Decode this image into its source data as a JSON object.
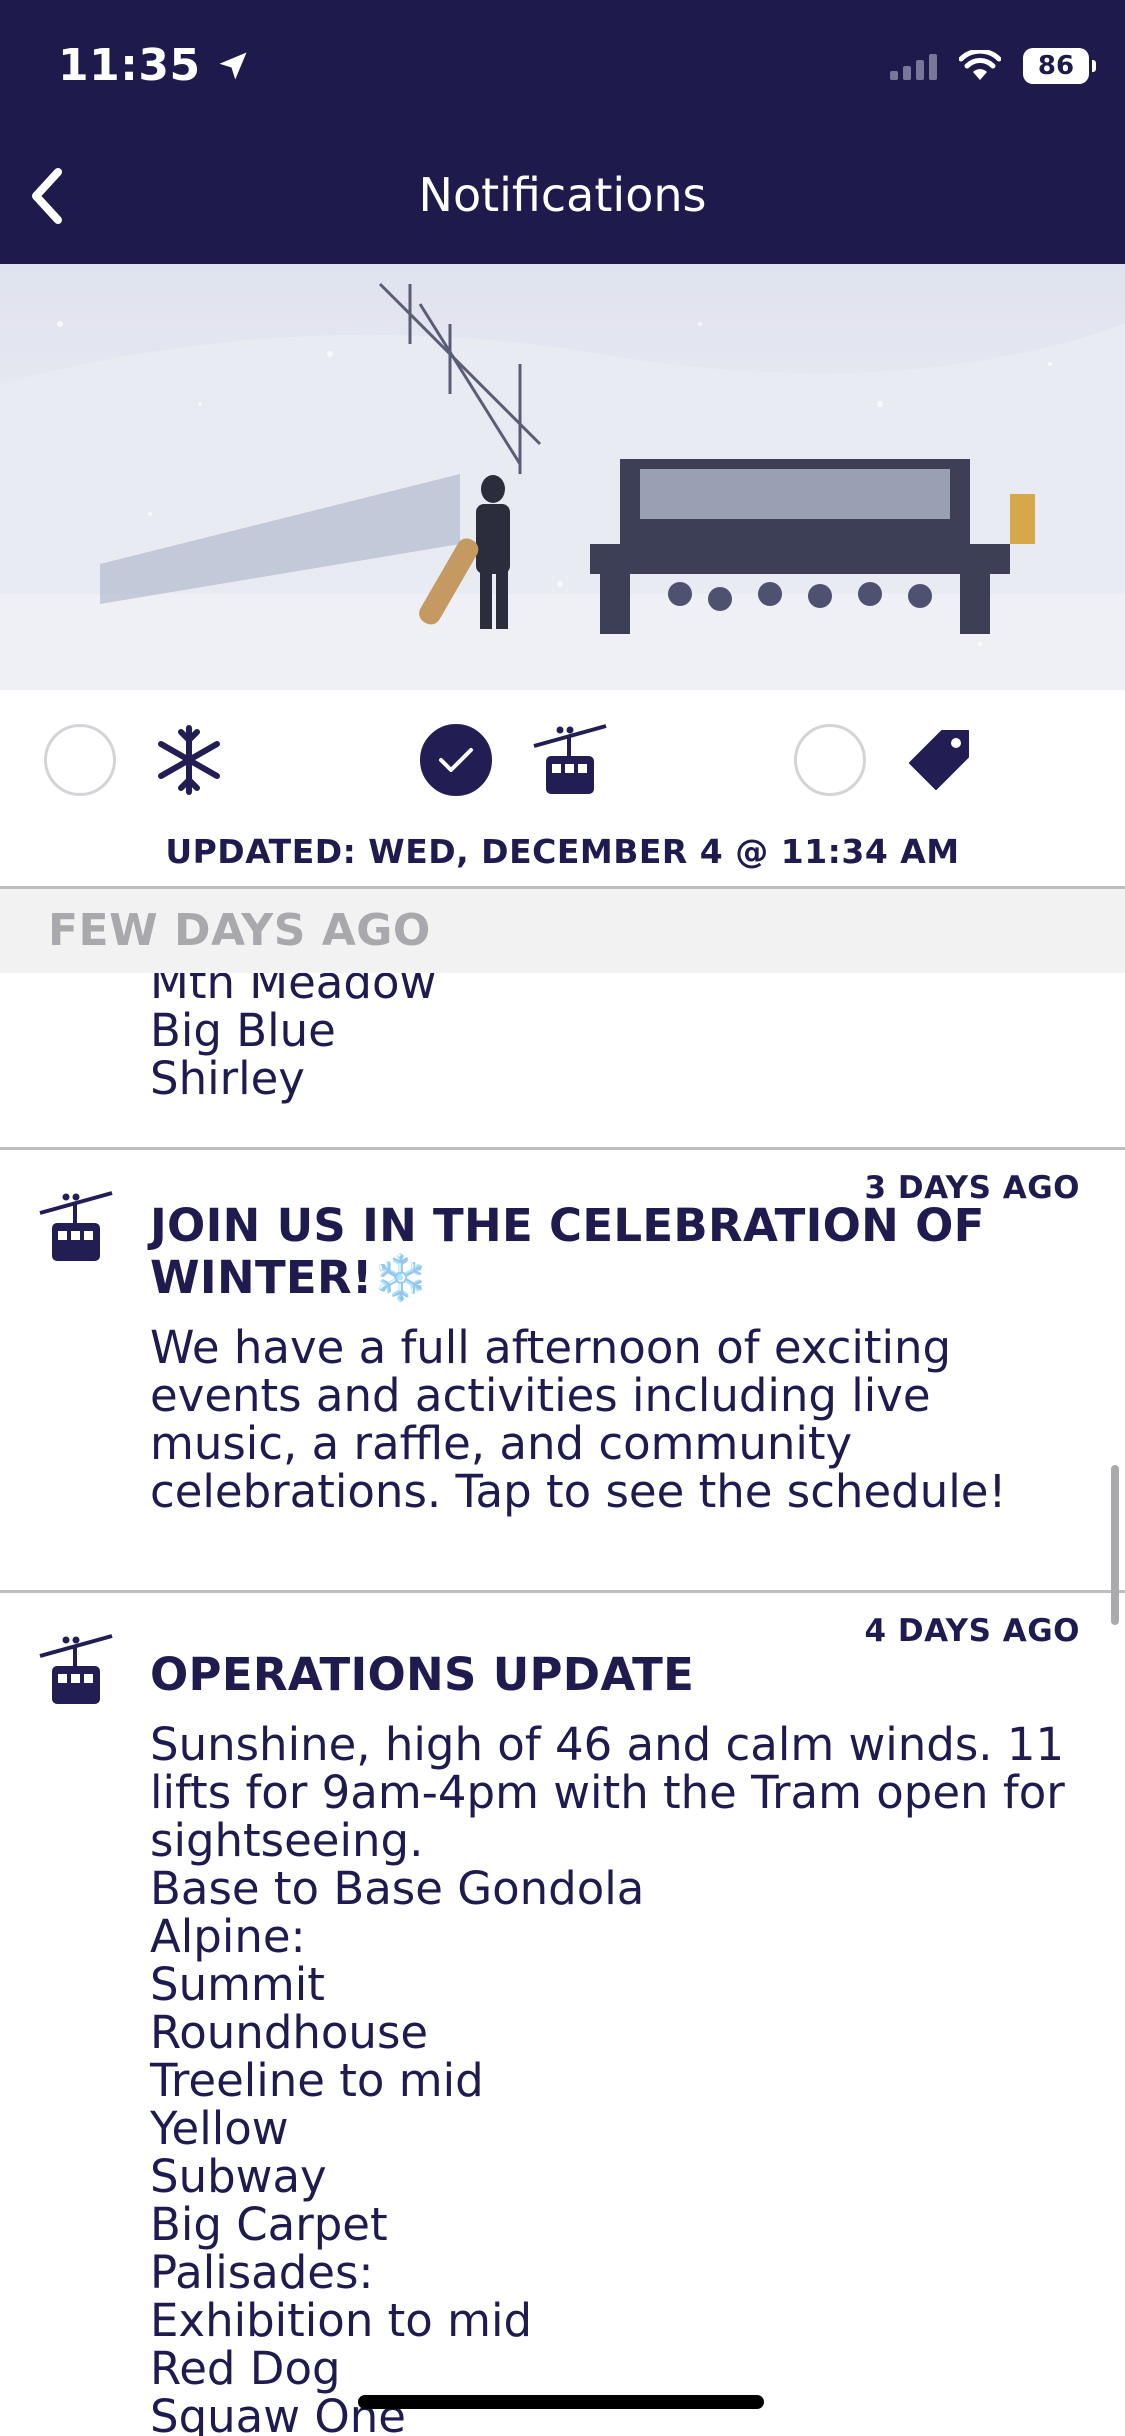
{
  "status_bar": {
    "time": "11:35",
    "battery": "86",
    "location_icon": "location-arrow-icon",
    "wifi_icon": "wifi-icon",
    "signal_icon": "cellular-signal-icon"
  },
  "nav": {
    "title": "Notifications",
    "back_icon": "chevron-left-icon"
  },
  "hero": {
    "image": "ski-lift-snowboarder-photo"
  },
  "filters": [
    {
      "icon": "snowflake-icon",
      "checked": false
    },
    {
      "icon": "gondola-icon",
      "checked": true
    },
    {
      "icon": "tag-icon",
      "checked": false
    }
  ],
  "updated_text": "UPDATED: WED, DECEMBER 4 @ 11:34 AM",
  "section_header": "FEW DAYS AGO",
  "partial_item": {
    "body_lines": [
      "Mtn Meadow",
      "Big Blue",
      "Shirley"
    ]
  },
  "notifications": [
    {
      "time": "3 DAYS AGO",
      "icon": "gondola-icon",
      "title": "JOIN US IN THE CELEBRATION OF WINTER!❄️",
      "body": "We have a full afternoon of exciting events and activities including live music, a raffle, and community celebrations. Tap to see the schedule!"
    },
    {
      "time": "4 DAYS AGO",
      "icon": "gondola-icon",
      "title": "OPERATIONS UPDATE",
      "body": "Sunshine, high of 46 and calm winds. 11 lifts for 9am-4pm with the Tram open for sightseeing.\nBase to Base Gondola\nAlpine:\nSummit\nRoundhouse\nTreeline to mid\nYellow\nSubway\nBig Carpet\nPalisades:\nExhibition to mid\nRed Dog\nSquaw One"
    }
  ],
  "colors": {
    "primary": "#1f1a4c",
    "text": "#1f1b4e",
    "divider": "#bdbdc2",
    "section_bg": "#f2f2f3"
  }
}
